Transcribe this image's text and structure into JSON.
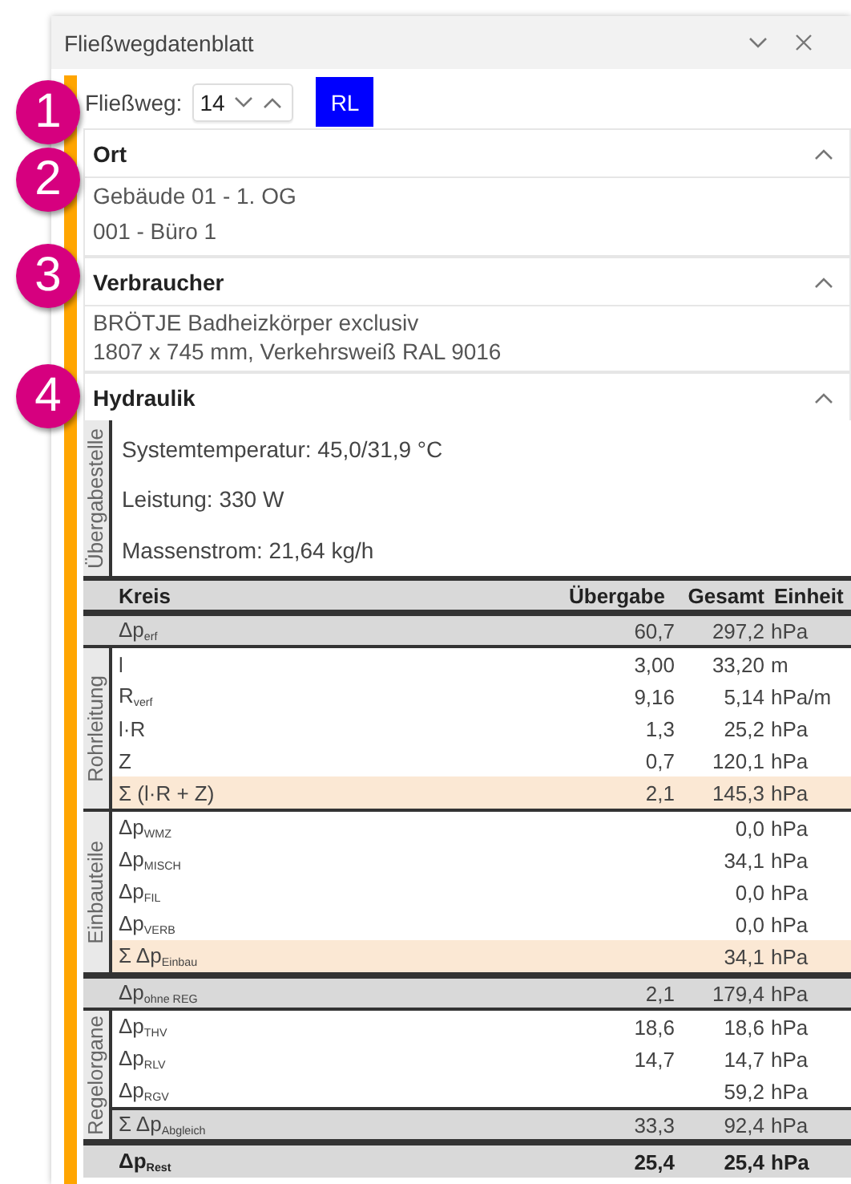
{
  "window": {
    "title": "Fließwegdatenblatt"
  },
  "callouts": [
    "1",
    "2",
    "3",
    "4"
  ],
  "flow_path": {
    "label": "Fließweg:",
    "value": "14",
    "button": "RL"
  },
  "sections": [
    {
      "kind": "fields",
      "title": "Ort",
      "expanded": true,
      "lines": [
        "Gebäude 01 - 1. OG",
        "001 - Büro 1"
      ]
    },
    {
      "kind": "text",
      "title": "Verbraucher",
      "expanded": true,
      "lines": [
        "BRÖTJE Badheizkörper exclusiv",
        "1807 x 745 mm, Verkehrsweiß RAL 9016"
      ]
    },
    {
      "kind": "hydraulics",
      "title": "Hydraulik",
      "expanded": true,
      "transfer_point": {
        "label": "Übergabestelle",
        "lines": [
          "Systemtemperatur: 45,0/31,9 °C",
          "Leistung: 330 W",
          "Massenstrom: 21,64 kg/h"
        ]
      },
      "table": {
        "columns": [
          "Kreis",
          "Übergabe",
          "Gesamt",
          "Einheit"
        ],
        "blocks": [
          {
            "kind": "total",
            "label": "Δp$_{erf}$",
            "transfer": "60,7",
            "total": "297,2",
            "unit": "hPa"
          },
          {
            "kind": "group",
            "label": "Rohrleitung",
            "rows": [
              {
                "kind": "item",
                "label": "l",
                "transfer": "3,00",
                "total": "33,20",
                "unit": "m"
              },
              {
                "kind": "item",
                "label": "R$_{verf}$",
                "transfer": "9,16",
                "total": "5,14",
                "unit": "hPa/m"
              },
              {
                "kind": "item",
                "label": "l·R",
                "transfer": "1,3",
                "total": "25,2",
                "unit": "hPa"
              },
              {
                "kind": "item",
                "label": "Z",
                "transfer": "0,7",
                "total": "120,1",
                "unit": "hPa"
              },
              {
                "kind": "sum",
                "label": "Σ (l·R + Z)",
                "transfer": "2,1",
                "total": "145,3",
                "unit": "hPa"
              }
            ]
          },
          {
            "kind": "group",
            "label": "Einbauteile",
            "rows": [
              {
                "kind": "item",
                "label": "Δp$_{WMZ}$",
                "total": "0,0",
                "unit": "hPa"
              },
              {
                "kind": "item",
                "label": "Δp$_{MISCH}$",
                "total": "34,1",
                "unit": "hPa"
              },
              {
                "kind": "item",
                "label": "Δp$_{FIL}$",
                "total": "0,0",
                "unit": "hPa"
              },
              {
                "kind": "item",
                "label": "Δp$_{VERB}$",
                "total": "0,0",
                "unit": "hPa"
              },
              {
                "kind": "sum",
                "label": "Σ Δp$_{Einbau}$",
                "total": "34,1",
                "unit": "hPa"
              }
            ]
          },
          {
            "kind": "total",
            "label": "Δp$_{ohne REG}$",
            "transfer": "2,1",
            "total": "179,4",
            "unit": "hPa"
          },
          {
            "kind": "group",
            "label": "Regelorgane",
            "rows": [
              {
                "kind": "item",
                "label": "Δp$_{THV}$",
                "transfer": "18,6",
                "total": "18,6",
                "unit": "hPa"
              },
              {
                "kind": "item",
                "label": "Δp$_{RLV}$",
                "transfer": "14,7",
                "total": "14,7",
                "unit": "hPa"
              },
              {
                "kind": "item",
                "label": "Δp$_{RGV}$",
                "total": "59,2",
                "unit": "hPa"
              },
              {
                "kind": "total",
                "label": "Σ Δp$_{Abgleich}$",
                "transfer": "33,3",
                "total": "92,4",
                "unit": "hPa"
              }
            ]
          },
          {
            "kind": "final",
            "label": "Δp$_{Rest}$",
            "transfer": "25,4",
            "total": "25,4",
            "unit": "hPa"
          }
        ]
      }
    }
  ]
}
